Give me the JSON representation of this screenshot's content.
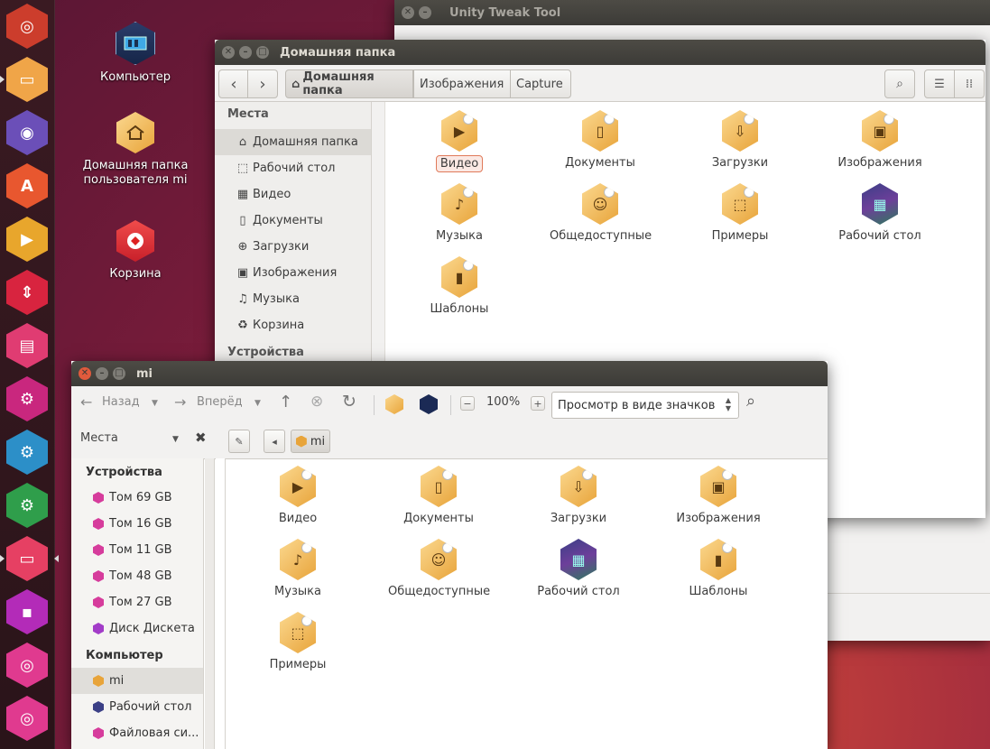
{
  "desktop": {
    "icons": [
      {
        "label": "Компьютер",
        "icon": "computer-icon"
      },
      {
        "label": "Домашняя папка пользователя mi",
        "icon": "home-folder-icon"
      },
      {
        "label": "Корзина",
        "icon": "trash-icon"
      }
    ]
  },
  "launcher": {
    "items": [
      {
        "name": "ubuntu-logo-icon",
        "glyph": "◎",
        "color": "#cc3d2c"
      },
      {
        "name": "files-icon",
        "glyph": "▭",
        "color": "#f0a548"
      },
      {
        "name": "firefox-icon",
        "glyph": "◉",
        "color": "#6b4fb8"
      },
      {
        "name": "software-center-icon",
        "glyph": "A",
        "color": "#e8572f"
      },
      {
        "name": "media-player-icon",
        "glyph": "▶",
        "color": "#e8a62c"
      },
      {
        "name": "updates-icon",
        "glyph": "⇕",
        "color": "#d8243f"
      },
      {
        "name": "toolbox-icon",
        "glyph": "▤",
        "color": "#e03c72"
      },
      {
        "name": "system-settings-icon",
        "glyph": "⚙",
        "color": "#c9277e"
      },
      {
        "name": "unity-tweak-icon",
        "glyph": "⚙",
        "color": "#2c8fc8"
      },
      {
        "name": "update-manager-icon",
        "glyph": "⚙",
        "color": "#2f9e4b"
      },
      {
        "name": "file-manager-icon",
        "glyph": "▭",
        "color": "#e64063"
      },
      {
        "name": "save-icon",
        "glyph": "▪",
        "color": "#b32bb8"
      },
      {
        "name": "disc-icon",
        "glyph": "◎",
        "color": "#e03a8f"
      },
      {
        "name": "disc-2-icon",
        "glyph": "◎",
        "color": "#e03a8f"
      }
    ]
  },
  "tweak_window": {
    "title": "Unity Tweak Tool"
  },
  "home_window": {
    "title": "Домашняя папка",
    "breadcrumbs": [
      "Домашняя папка",
      "Изображения",
      "Capture"
    ],
    "sidebar_head": "Места",
    "sidebar_items": [
      "Домашняя папка",
      "Рабочий стол",
      "Видео",
      "Документы",
      "Загрузки",
      "Изображения",
      "Музыка",
      "Корзина"
    ],
    "sidebar_head2": "Устройства",
    "items": [
      "Видео",
      "Документы",
      "Загрузки",
      "Изображения",
      "Музыка",
      "Общедоступные",
      "Примеры",
      "Рабочий стол",
      "Шаблоны"
    ]
  },
  "mi_window": {
    "title": "mi",
    "back_label": "Назад",
    "forward_label": "Вперёд",
    "zoom": "100%",
    "view_mode": "Просмотр в виде значков",
    "places_label": "Места",
    "path_button": "mi",
    "sidebar_devices_head": "Устройства",
    "devices": [
      "Том 69 GB",
      "Том 16 GB",
      "Том 11 GB",
      "Том 48 GB",
      "Том 27 GB",
      "Диск Дискета"
    ],
    "sidebar_computer_head": "Компьютер",
    "computer_items": [
      "mi",
      "Рабочий стол",
      "Файловая си..."
    ],
    "items": [
      "Видео",
      "Документы",
      "Загрузки",
      "Изображения",
      "Музыка",
      "Общедоступные",
      "Рабочий стол",
      "Шаблоны",
      "Примеры"
    ]
  }
}
